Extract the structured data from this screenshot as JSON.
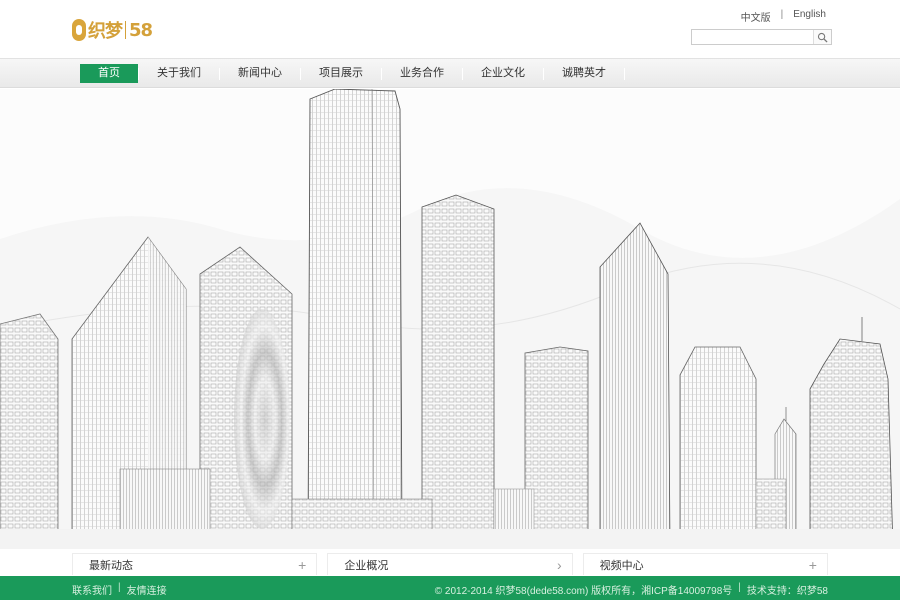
{
  "header": {
    "logo": {
      "text_left": "织梦",
      "text_right": "58",
      "accent": "#d4a13a"
    },
    "lang": {
      "cn": "中文版",
      "sep": "|",
      "en": "English"
    },
    "search": {
      "placeholder": "",
      "icon": "search-icon"
    }
  },
  "nav": {
    "items": [
      {
        "label": "首页",
        "active": true
      },
      {
        "label": "关于我们"
      },
      {
        "label": "新闻中心"
      },
      {
        "label": "项目展示"
      },
      {
        "label": "业务合作"
      },
      {
        "label": "企业文化"
      },
      {
        "label": "诚聘英才"
      }
    ],
    "active_color": "#1a9a5a"
  },
  "info": [
    {
      "title": "最新动态",
      "action": "+"
    },
    {
      "title": "企业概况",
      "action": "›"
    },
    {
      "title": "视频中心",
      "action": "+"
    }
  ],
  "footer": {
    "left": [
      "联系我们",
      "|",
      "友情连接"
    ],
    "right": [
      "© 2012-2014 织梦58(dede58.com) 版权所有，湘ICP备14009798号",
      "|",
      "技术支持：织梦58"
    ],
    "bg": "#1a9a5a"
  }
}
